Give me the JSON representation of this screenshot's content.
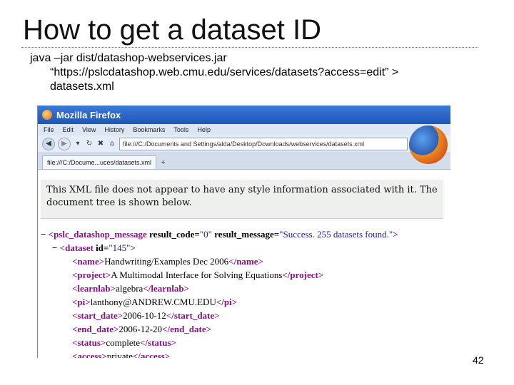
{
  "slide": {
    "title": "How to get a dataset ID",
    "command_lines": [
      "java –jar dist/datashop-webservices.jar",
      "“https://pslcdatashop.web.cmu.edu/services/datasets?access=edit” >",
      "datasets.xml"
    ],
    "page_number": "42"
  },
  "browser": {
    "window_title": "Mozilla Firefox",
    "menu": [
      "File",
      "Edit",
      "View",
      "History",
      "Bookmarks",
      "Tools",
      "Help"
    ],
    "url": "file:///C:/Documents and Settings/alda/Desktop/Downloads/webservices/datasets.xml",
    "tab_label": "file:///C:/Docume...uces/datasets.xml",
    "new_tab": "+",
    "icons": {
      "back": "◀",
      "forward": "▶",
      "dropdown": "▾",
      "reload": "↻",
      "stop": "✖",
      "home": "⌂"
    },
    "notice": "This XML file does not appear to have any style information associated with it. The document tree is shown below.",
    "xml": {
      "collapse": "−",
      "root": {
        "tag": "pslc_datashop_message",
        "attr1_name": "result_code",
        "attr1_value": "\"0\"",
        "attr2_name": "result_message",
        "attr2_value": "\"Success. 255 datasets found.\""
      },
      "dataset": {
        "tag": "dataset",
        "attr_name": "id",
        "attr_value": "\"145\""
      },
      "children": [
        {
          "tag": "name",
          "text": "Handwriting/Examples Dec 2006"
        },
        {
          "tag": "project",
          "text": "A Multimodal Interface for Solving Equations"
        },
        {
          "tag": "learnlab",
          "text": "algebra"
        },
        {
          "tag": "pi",
          "text": "lanthony@ANDREW.CMU.EDU"
        },
        {
          "tag": "start_date",
          "text": "2006-10-12"
        },
        {
          "tag": "end_date",
          "text": "2006-12-20"
        },
        {
          "tag": "status",
          "text": "complete"
        },
        {
          "tag": "access",
          "text": "private"
        }
      ]
    }
  }
}
